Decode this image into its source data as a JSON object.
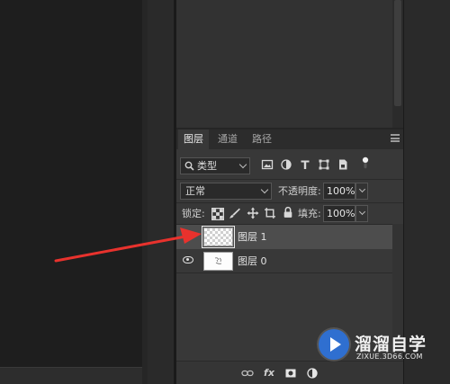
{
  "layers_panel": {
    "tabs": [
      {
        "label": "图层"
      },
      {
        "label": "通道"
      },
      {
        "label": "路径"
      }
    ],
    "filter": {
      "kind_label": "类型",
      "icon_names": [
        "image-filter-icon",
        "adjustment-filter-icon",
        "type-filter-icon",
        "shape-filter-icon",
        "smart-object-filter-icon",
        "filter-toggle-icon"
      ]
    },
    "blend_mode": "正常",
    "opacity_label": "不透明度:",
    "opacity_value": "100%",
    "lock_label": "锁定:",
    "fill_label": "填充:",
    "fill_value": "100%",
    "layers": [
      {
        "name": "图层 1",
        "visible": true,
        "selected": true,
        "thumbnail": "transparent"
      },
      {
        "name": "图层 0",
        "visible": true,
        "selected": false,
        "thumbnail": "sketch"
      }
    ],
    "bottom_icons": [
      "link-icon",
      "fx-icon",
      "mask-icon",
      "adjustment-icon"
    ],
    "fx_label": "fx"
  },
  "annotation": {
    "arrow_color": "#e8322d"
  },
  "watermark": {
    "title": "溜溜自学",
    "url": "ZIXUE.3D66.COM",
    "badge_color": "#2f6fd0"
  },
  "colors": {
    "panel_bg": "#383838",
    "selected_row": "#4d4d4d",
    "canvas_bg": "#1e1e1e"
  }
}
